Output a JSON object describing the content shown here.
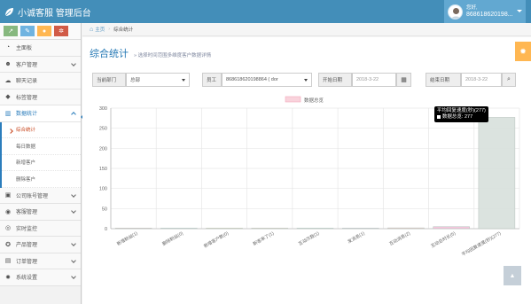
{
  "app": {
    "title": "小诚客服 管理后台",
    "brand_color": "#438eb9"
  },
  "user": {
    "greeting": "您好,",
    "name": "868618620198..."
  },
  "shortcuts": [
    {
      "icon": "signal-icon",
      "color": "#87b87f",
      "glyph": "↗"
    },
    {
      "icon": "pencil-icon",
      "color": "#6fb3e0",
      "glyph": "✎"
    },
    {
      "icon": "users-icon",
      "color": "#ffb752",
      "glyph": "●"
    },
    {
      "icon": "cogs-icon",
      "color": "#d15b47",
      "glyph": "✲"
    }
  ],
  "sidebar": {
    "items": [
      {
        "label": "主面板",
        "icon": "dashboard-icon",
        "glyph": "◔",
        "chevron": false
      },
      {
        "label": "客户管理",
        "icon": "users-icon",
        "glyph": "☻",
        "chevron": true
      },
      {
        "label": "聊天记录",
        "icon": "comments-icon",
        "glyph": "☁",
        "chevron": false
      },
      {
        "label": "标签管理",
        "icon": "tag-icon",
        "glyph": "◆",
        "chevron": false
      },
      {
        "label": "数据统计",
        "icon": "bar-chart-icon",
        "glyph": "▥",
        "chevron": true,
        "open": true
      },
      {
        "label": "公司账号管理",
        "icon": "briefcase-icon",
        "glyph": "▣",
        "chevron": true
      },
      {
        "label": "客服管理",
        "icon": "support-icon",
        "glyph": "◉",
        "chevron": true
      },
      {
        "label": "实时监控",
        "icon": "eye-icon",
        "glyph": "◎",
        "chevron": false
      },
      {
        "label": "产品管理",
        "icon": "product-icon",
        "glyph": "✪",
        "chevron": true
      },
      {
        "label": "订单管理",
        "icon": "order-icon",
        "glyph": "▤",
        "chevron": true
      },
      {
        "label": "系统设置",
        "icon": "settings-icon",
        "glyph": "✹",
        "chevron": true
      }
    ],
    "sub_items": [
      {
        "label": "综合统计",
        "active": true
      },
      {
        "label": "每日数据",
        "active": false
      },
      {
        "label": "新增客户",
        "active": false
      },
      {
        "label": "删除客户",
        "active": false
      }
    ]
  },
  "breadcrumb": {
    "home": "主页",
    "current": "综合统计"
  },
  "page": {
    "title": "综合统计",
    "subtitle": "选择时间范围多维度客户数据详情"
  },
  "filters": {
    "dept_label": "当前部门",
    "dept_value": "总部",
    "staff_label": "员工",
    "staff_value": "868618620198864 ( dor",
    "start_label": "开始日期",
    "start_value": "2018-3-22",
    "end_label": "结束日期",
    "end_value": "2018-3-22"
  },
  "chart_data": {
    "type": "bar",
    "legend": "数据总览",
    "categories": [
      "新增粉丝(1)",
      "删除粉丝(0)",
      "新增客户数(0)",
      "新客来了(1)",
      "互动次数(1)",
      "发消息(1)",
      "互动消息(2)",
      "互动总时长(5)",
      "平均回复速度(秒)(277)"
    ],
    "values": [
      1,
      0,
      0,
      1,
      1,
      1,
      2,
      5,
      277
    ],
    "series_colors": [
      "#f2b6c3",
      "#b8dcf5",
      "#f5e2a8",
      "#f5d8b8",
      "#bde5e5",
      "#d8c8f0",
      "#f0c8c0",
      "#f2c0d8",
      "#d7e0db"
    ],
    "ylim": [
      0,
      300
    ],
    "yticks": [
      0,
      50,
      100,
      150,
      200,
      250,
      300
    ],
    "grid": true,
    "tooltip": {
      "title": "平均回复速度(秒)(277)",
      "line": "数据总览: 277"
    }
  }
}
